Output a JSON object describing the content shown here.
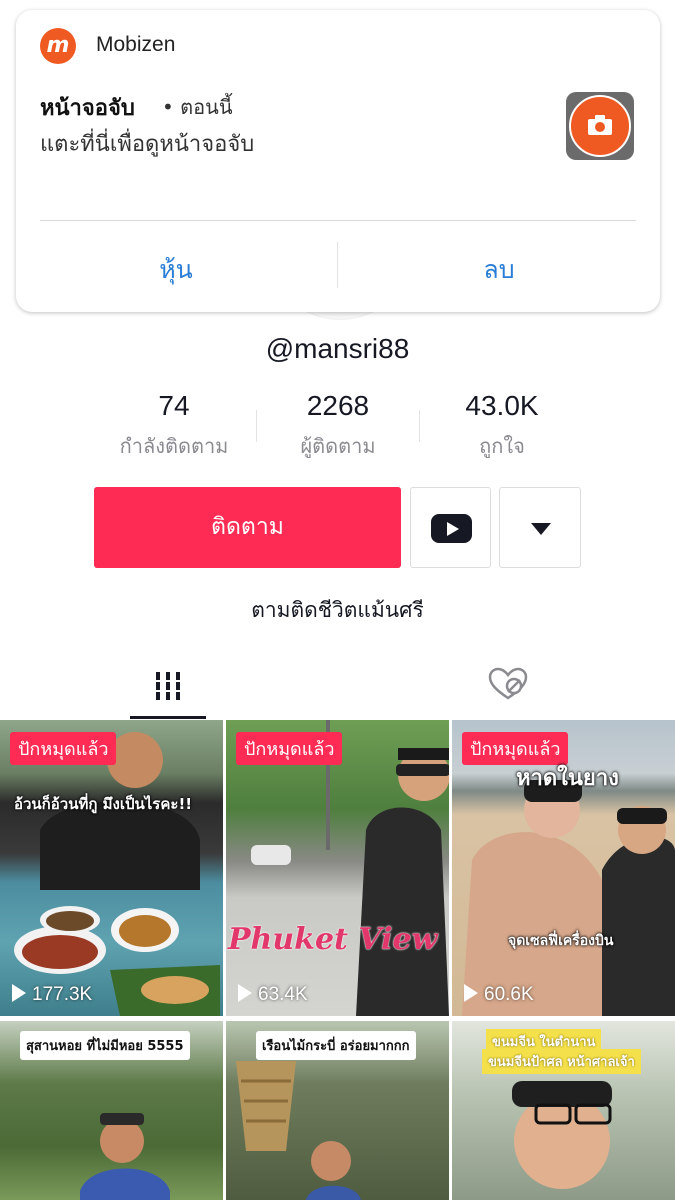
{
  "header": {
    "title": "mansri"
  },
  "notification": {
    "app_name": "Mobizen",
    "title": "หน้าจอจับ",
    "time": "• ตอนนี้",
    "body": "แตะที่นี่เพื่อดูหน้าจอจับ",
    "action_hide": "หุ้น",
    "action_delete": "ลบ",
    "accent_color": "#ef5a23",
    "action_color": "#2a7dd6"
  },
  "profile": {
    "handle": "@mansri88",
    "stats": [
      {
        "value": "74",
        "label": "กำลังติดตาม"
      },
      {
        "value": "2268",
        "label": "ผู้ติดตาม"
      },
      {
        "value": "43.0K",
        "label": "ถูกใจ"
      }
    ],
    "follow_label": "ติดตาม",
    "bio": "ตามติดชีวิตแม้นศรี",
    "brand_color": "#fe2c55"
  },
  "tabs": [
    {
      "icon": "grid-icon",
      "active": true
    },
    {
      "icon": "liked-heart-hidden-icon",
      "active": false
    }
  ],
  "videos": [
    {
      "pinned": "ปักหมุดแล้ว",
      "caption": "อ้วนก็อ้วนที่กู มึงเป็นไรคะ!!",
      "views": "177.3K"
    },
    {
      "pinned": "ปักหมุดแล้ว",
      "caption": "Phuket View",
      "views": "63.4K"
    },
    {
      "pinned": "ปักหมุดแล้ว",
      "caption": "หาดในยาง",
      "sub_caption": "จุดเซลฟี่เครื่องบิน",
      "views": "60.6K"
    },
    {
      "caption": "สุสานหอย ที่ไม่มีหอย 5555"
    },
    {
      "caption": "เรือนไม้กระบี่ อร่อยมากกก"
    },
    {
      "caption": "ขนมจีน ในตำนาน",
      "sub_caption": "ขนมจีนป้าศล หน้าศาลเจ้า"
    }
  ]
}
